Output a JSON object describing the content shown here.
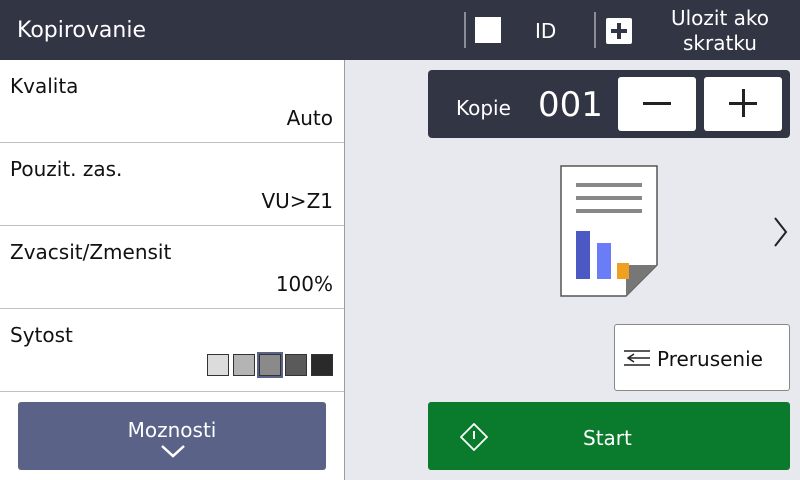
{
  "header": {
    "title": "Kopirovanie",
    "id_label": "ID",
    "shortcut_label": "Ulozit ako skratku"
  },
  "settings": [
    {
      "label": "Kvalita",
      "value": "Auto"
    },
    {
      "label": "Pouzit. zas.",
      "value": "VU>Z1"
    },
    {
      "label": "Zvacsit/Zmensit",
      "value": "100%"
    },
    {
      "label": "Sytost",
      "value": null
    }
  ],
  "density": {
    "levels": [
      "#dcdcdc",
      "#b4b4b4",
      "#8a8a8a",
      "#5a5a5a",
      "#2a2a2a"
    ],
    "selected_index": 2
  },
  "options_label": "Moznosti",
  "copies": {
    "label": "Kopie",
    "value": "001"
  },
  "interrupt_label": "Prerusenie",
  "start_label": "Start",
  "colors": {
    "header": "#323543",
    "options_button": "#5a6287",
    "start_button": "#0a7b2c",
    "chart_bar_1": "#4c58c3",
    "chart_bar_2": "#6a7cf6",
    "chart_bar_3": "#f0a020"
  },
  "icons": {
    "id": "square-icon",
    "shortcut": "plus-box-icon",
    "options": "chevron-down-icon",
    "next": "chevron-right-icon",
    "interrupt": "interrupt-icon",
    "start": "start-diamond-icon",
    "preview": "document-preview-icon"
  }
}
